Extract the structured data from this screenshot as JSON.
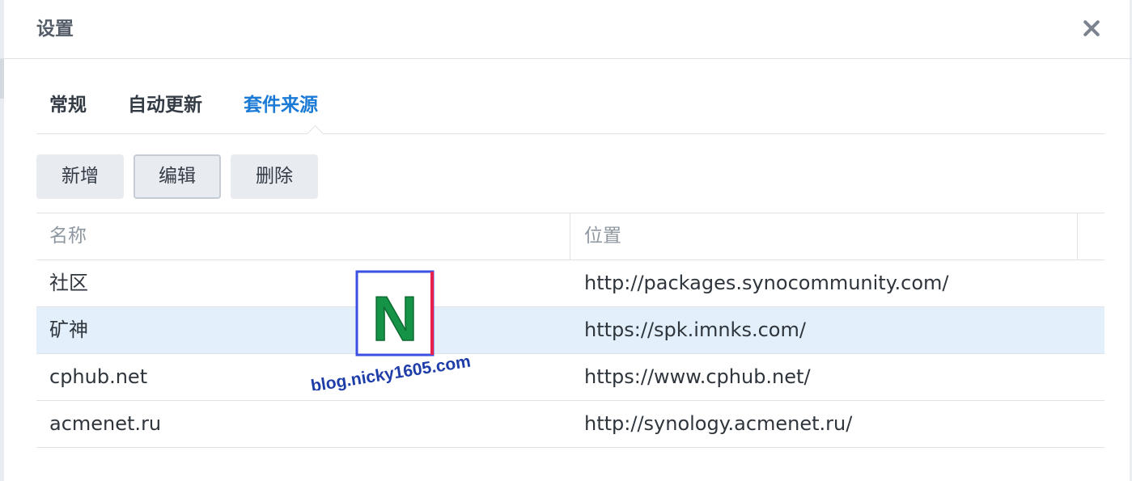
{
  "dialog": {
    "title": "设置",
    "close_icon": "close-icon"
  },
  "tabs": [
    {
      "label": "常规",
      "active": false
    },
    {
      "label": "自动更新",
      "active": false
    },
    {
      "label": "套件来源",
      "active": true
    }
  ],
  "toolbar": {
    "add_label": "新增",
    "edit_label": "编辑",
    "delete_label": "删除"
  },
  "table": {
    "columns": [
      "名称",
      "位置"
    ],
    "rows": [
      {
        "name": "社区",
        "location": "http://packages.synocommunity.com/",
        "selected": false
      },
      {
        "name": "矿神",
        "location": "https://spk.imnks.com/",
        "selected": true
      },
      {
        "name": "cphub.net",
        "location": "https://www.cphub.net/",
        "selected": false
      },
      {
        "name": "acmenet.ru",
        "location": "http://synology.acmenet.ru/",
        "selected": false
      }
    ]
  },
  "watermark": {
    "letter": "N",
    "text": "blog.nicky1605.com"
  },
  "colors": {
    "accent": "#1a7ad6",
    "selected_row": "#e3effa",
    "watermark_green": "#159447",
    "watermark_border": "#3b4fe0",
    "watermark_edge": "#e8214a"
  }
}
